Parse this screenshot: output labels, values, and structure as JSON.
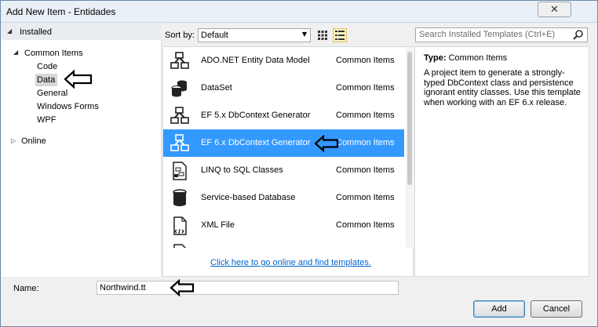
{
  "window": {
    "title": "Add New Item - Entidades",
    "close_label": "✕"
  },
  "tree": {
    "installed": "Installed",
    "common_items": "Common Items",
    "children": [
      "Code",
      "Data",
      "General",
      "Windows Forms",
      "WPF"
    ],
    "selected": "Data",
    "online": "Online"
  },
  "toolbar": {
    "sort_label": "Sort by:",
    "sort_value": "Default"
  },
  "search": {
    "placeholder": "Search Installed Templates (Ctrl+E)"
  },
  "templates": [
    {
      "name": "ADO.NET Entity Data Model",
      "category": "Common Items",
      "icon": "entity-model-icon"
    },
    {
      "name": "DataSet",
      "category": "Common Items",
      "icon": "dataset-icon"
    },
    {
      "name": "EF 5.x DbContext Generator",
      "category": "Common Items",
      "icon": "entity-model-icon"
    },
    {
      "name": "EF 6.x DbContext Generator",
      "category": "Common Items",
      "icon": "entity-model-icon",
      "selected": true
    },
    {
      "name": "LINQ to SQL Classes",
      "category": "Common Items",
      "icon": "linq-classes-icon"
    },
    {
      "name": "Service-based Database",
      "category": "Common Items",
      "icon": "database-icon"
    },
    {
      "name": "XML File",
      "category": "Common Items",
      "icon": "xml-file-icon"
    }
  ],
  "online_link": "Click here to go online and find templates.",
  "details": {
    "type_label": "Type:",
    "type_value": "Common Items",
    "description": "A project item to generate a strongly-typed DbContext class and persistence ignorant entity classes. Use this template when working with an EF 6.x release."
  },
  "name_field": {
    "label": "Name:",
    "value": "Northwind.tt"
  },
  "buttons": {
    "add": "Add",
    "cancel": "Cancel"
  },
  "colors": {
    "selection": "#3399ff",
    "link": "#0066cc",
    "annotation_arrow": "#000000"
  }
}
